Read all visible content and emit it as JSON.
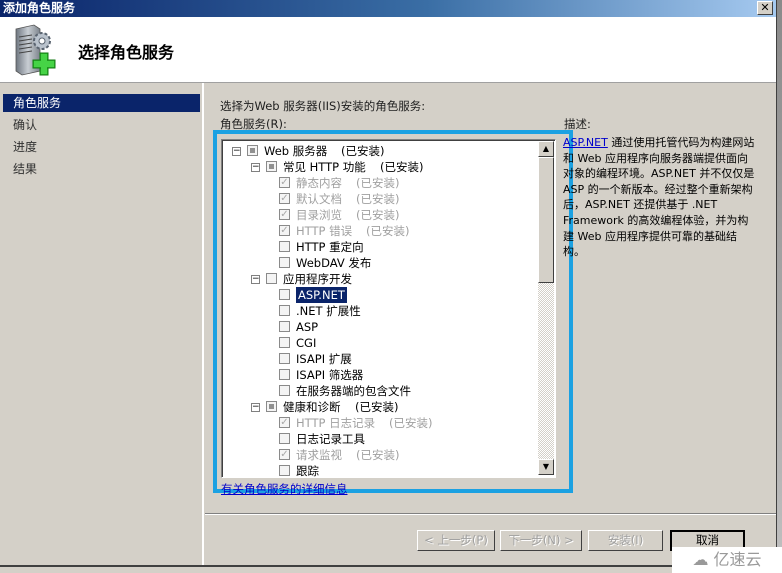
{
  "window": {
    "title": "添加角色服务",
    "close_label": "✕"
  },
  "header": {
    "title": "选择角色服务",
    "icon": "server-add-icon"
  },
  "nav": {
    "items": [
      {
        "label": "角色服务",
        "active": true
      },
      {
        "label": "确认",
        "active": false
      },
      {
        "label": "进度",
        "active": false
      },
      {
        "label": "结果",
        "active": false
      }
    ]
  },
  "main": {
    "instruction": "选择为Web 服务器(IIS)安装的角色服务:",
    "list_label": "角色服务(R):",
    "description_label": "描述:",
    "more_info_link": "有关角色服务的详细信息",
    "tree": [
      {
        "level": 0,
        "expander": "⊟",
        "state": "partial",
        "label": "Web 服务器",
        "status": "(已安装)",
        "disabled": false
      },
      {
        "level": 1,
        "expander": "⊟",
        "state": "partial",
        "label": "常见 HTTP 功能",
        "status": "(已安装)",
        "disabled": false
      },
      {
        "level": 2,
        "state": "checked",
        "label": "静态内容",
        "status": "(已安装)",
        "disabled": true
      },
      {
        "level": 2,
        "state": "checked",
        "label": "默认文档",
        "status": "(已安装)",
        "disabled": true
      },
      {
        "level": 2,
        "state": "checked",
        "label": "目录浏览",
        "status": "(已安装)",
        "disabled": true
      },
      {
        "level": 2,
        "state": "checked",
        "label": "HTTP 错误",
        "status": "(已安装)",
        "disabled": true
      },
      {
        "level": 2,
        "state": "unchecked",
        "label": "HTTP 重定向",
        "status": "",
        "disabled": false
      },
      {
        "level": 2,
        "state": "unchecked",
        "label": "WebDAV 发布",
        "status": "",
        "disabled": false
      },
      {
        "level": 1,
        "expander": "⊟",
        "state": "unchecked",
        "label": "应用程序开发",
        "status": "",
        "disabled": false
      },
      {
        "level": 2,
        "state": "unchecked",
        "label": "ASP.NET",
        "status": "",
        "disabled": false,
        "selected": true
      },
      {
        "level": 2,
        "state": "unchecked",
        "label": ".NET 扩展性",
        "status": "",
        "disabled": false
      },
      {
        "level": 2,
        "state": "unchecked",
        "label": "ASP",
        "status": "",
        "disabled": false
      },
      {
        "level": 2,
        "state": "unchecked",
        "label": "CGI",
        "status": "",
        "disabled": false
      },
      {
        "level": 2,
        "state": "unchecked",
        "label": "ISAPI 扩展",
        "status": "",
        "disabled": false
      },
      {
        "level": 2,
        "state": "unchecked",
        "label": "ISAPI 筛选器",
        "status": "",
        "disabled": false
      },
      {
        "level": 2,
        "state": "unchecked",
        "label": "在服务器端的包含文件",
        "status": "",
        "disabled": false
      },
      {
        "level": 1,
        "expander": "⊟",
        "state": "partial",
        "label": "健康和诊断",
        "status": "(已安装)",
        "disabled": false
      },
      {
        "level": 2,
        "state": "checked",
        "label": "HTTP 日志记录",
        "status": "(已安装)",
        "disabled": true
      },
      {
        "level": 2,
        "state": "unchecked",
        "label": "日志记录工具",
        "status": "",
        "disabled": false
      },
      {
        "level": 2,
        "state": "checked",
        "label": "请求监视",
        "status": "(已安装)",
        "disabled": true
      },
      {
        "level": 2,
        "state": "unchecked",
        "label": "跟踪",
        "status": "",
        "disabled": false
      }
    ],
    "description": {
      "link": "ASP.NET",
      "text": " 通过使用托管代码为构建网站和 Web 应用程序向服务器端提供面向对象的编程环境。ASP.NET 并不仅仅是 ASP 的一个新版本。经过整个重新架构后，ASP.NET 还提供基于 .NET Framework 的高效编程体验，并为构建 Web 应用程序提供可靠的基础结构。"
    },
    "scrollbar": {
      "up": "▲",
      "down": "▼"
    }
  },
  "buttons": {
    "back": "< 上一步(P)",
    "next": "下一步(N) >",
    "install": "安装(I)",
    "cancel": "取消"
  },
  "watermark": "亿速云",
  "colors": {
    "highlight_border": "#1ba1e2",
    "selection": "#0a246a",
    "link": "#0000cc"
  }
}
